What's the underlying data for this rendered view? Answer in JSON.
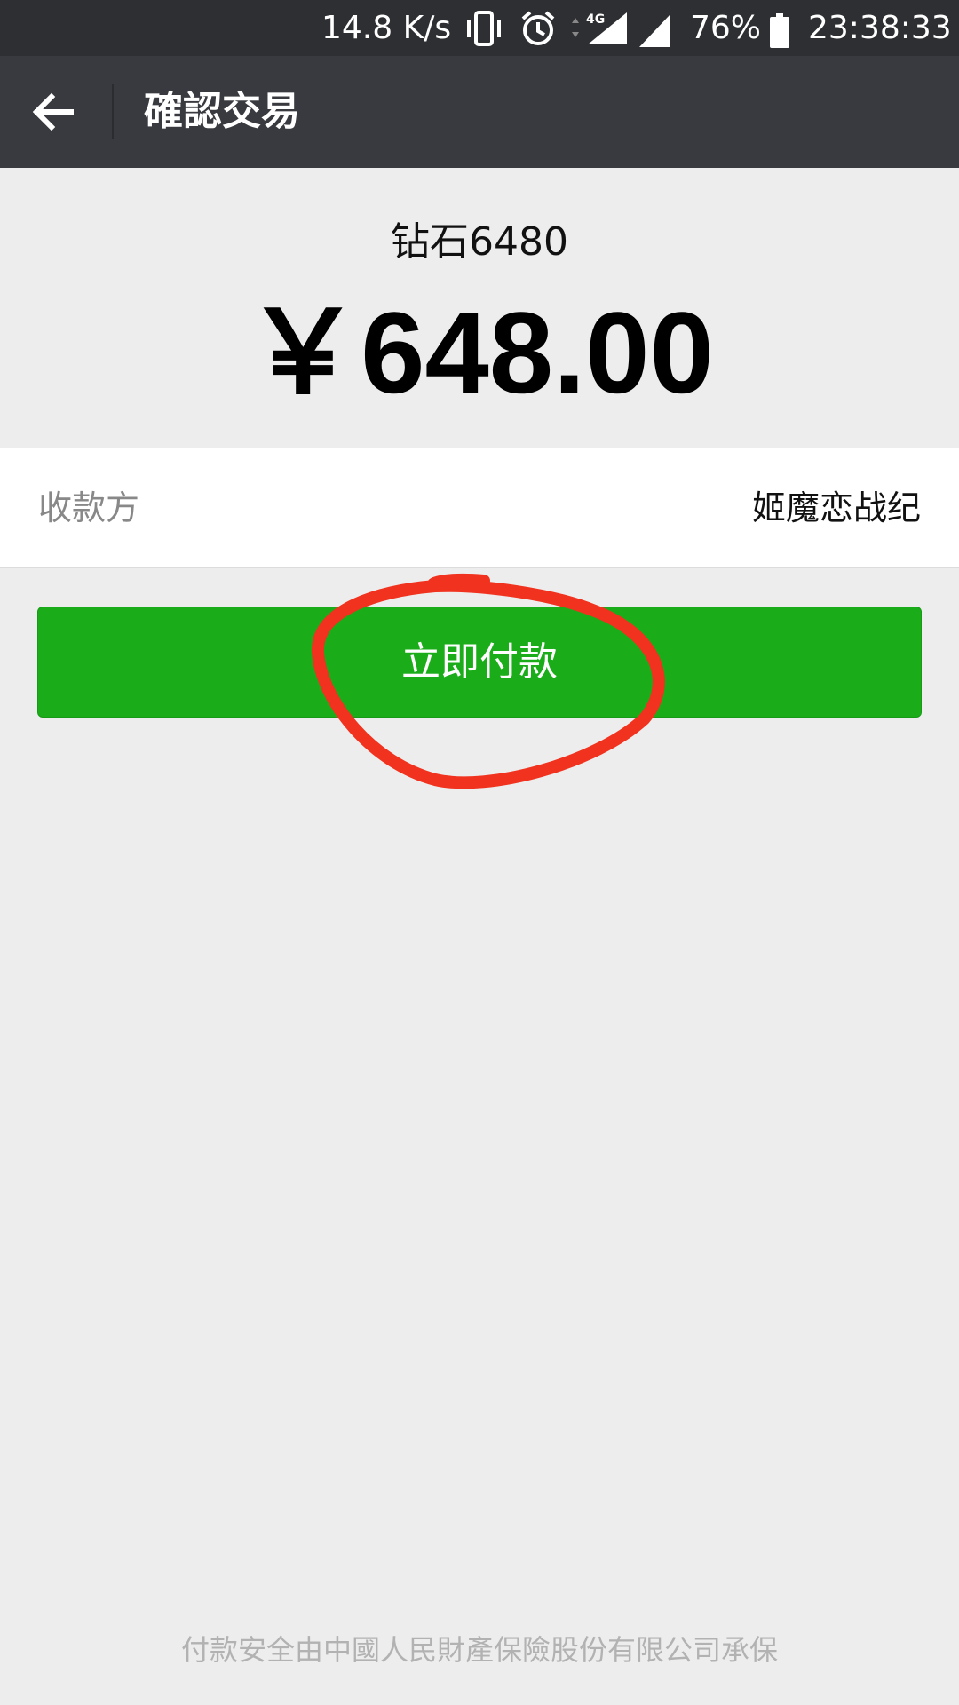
{
  "status_bar": {
    "network_speed": "14.8 K/s",
    "network_type": "4G",
    "battery_percent": "76%",
    "time": "23:38:33"
  },
  "header": {
    "title": "確認交易"
  },
  "order": {
    "product_name": "钻石6480",
    "amount": "￥648.00"
  },
  "payee": {
    "label": "收款方",
    "value": "姬魔恋战纪"
  },
  "actions": {
    "pay_label": "立即付款"
  },
  "footer": {
    "note": "付款安全由中國人民財產保險股份有限公司承保"
  },
  "colors": {
    "status_bar": "#2e2f33",
    "header_bg": "#393a3f",
    "page_bg": "#ededed",
    "primary_button": "#1aad19",
    "annotation": "#f0321e"
  }
}
